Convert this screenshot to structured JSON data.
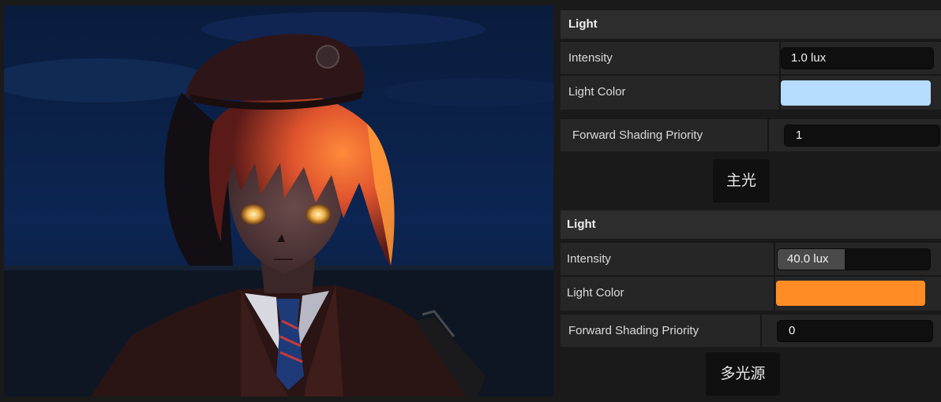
{
  "lights": [
    {
      "header": "Light",
      "intensity_label": "Intensity",
      "intensity_value": "1.0 lux",
      "intensity_fill": 0,
      "color_label": "Light Color",
      "color": "#b6dcff",
      "priority_label": "Forward Shading Priority",
      "priority_value": "1",
      "button_label": "主光"
    },
    {
      "header": "Light",
      "intensity_label": "Intensity",
      "intensity_value": "40.0 lux",
      "intensity_fill": 0.44,
      "color_label": "Light Color",
      "color": "#ff8c25",
      "priority_label": "Forward Shading Priority",
      "priority_value": "0",
      "button_label": "多光源"
    }
  ],
  "colors": {
    "panel_bg": "#262626",
    "header_bg": "#2d2d2d",
    "field_bg": "#0f0f0f",
    "rim_light": "#ff7a2a",
    "sky": "#0b2348"
  }
}
